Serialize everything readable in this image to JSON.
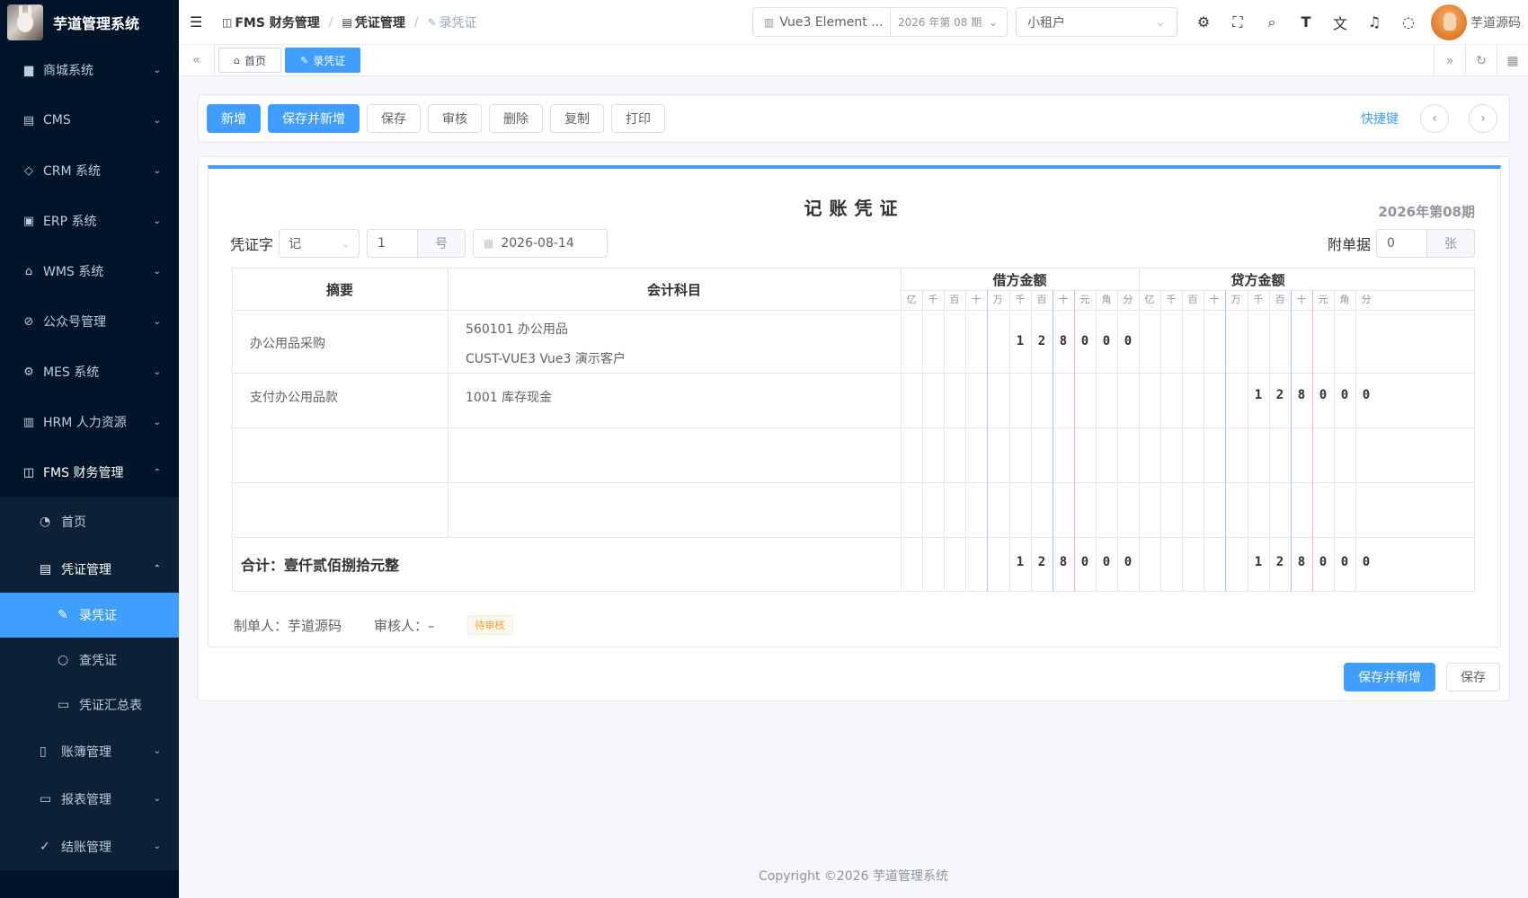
{
  "app": {
    "title": "芋道管理系统"
  },
  "sidebar": {
    "items": [
      {
        "label": "商城系统",
        "icon": "shop-icon"
      },
      {
        "label": "CMS",
        "icon": "document-icon"
      },
      {
        "label": "CRM 系统",
        "icon": "tag-icon"
      },
      {
        "label": "ERP 系统",
        "icon": "erp-icon"
      },
      {
        "label": "WMS 系统",
        "icon": "warehouse-icon"
      },
      {
        "label": "公众号管理",
        "icon": "compass-icon"
      },
      {
        "label": "MES 系统",
        "icon": "chip-icon"
      },
      {
        "label": "HRM 人力资源",
        "icon": "building-icon"
      },
      {
        "label": "FMS 财务管理",
        "icon": "finance-icon"
      }
    ],
    "fms_sub": {
      "home": "首页",
      "voucher_mgmt": "凭证管理",
      "record_voucher": "录凭证",
      "query_voucher": "查凭证",
      "voucher_summary": "凭证汇总表",
      "ledger_mgmt": "账簿管理",
      "report_mgmt": "报表管理",
      "closing_mgmt": "结账管理"
    }
  },
  "header": {
    "breadcrumb": [
      "FMS 财务管理",
      "凭证管理",
      "录凭证"
    ],
    "ledger": "Vue3 Element ...",
    "period": "2026 年第 08 期",
    "tenant": "小租户",
    "user": "芋道源码"
  },
  "tags": {
    "home": "首页",
    "current": "录凭证"
  },
  "toolbar": {
    "add": "新增",
    "save_and_add": "保存并新增",
    "save": "保存",
    "audit": "审核",
    "delete": "删除",
    "copy": "复制",
    "print": "打印",
    "shortcut": "快捷键"
  },
  "voucher": {
    "title": "记账凭证",
    "period_label": "2026年第08期",
    "word_label": "凭证字",
    "word_value": "记",
    "number": "1",
    "number_suffix": "号",
    "date": "2026-08-14",
    "attach_label": "附单据",
    "attach_count": "0",
    "attach_suffix": "张",
    "col_summary": "摘要",
    "col_account": "会计科目",
    "col_debit": "借方金额",
    "col_credit": "贷方金额",
    "units": [
      "亿",
      "千",
      "百",
      "十",
      "万",
      "千",
      "百",
      "十",
      "元",
      "角",
      "分"
    ],
    "rows": [
      {
        "summary": "办公用品采购",
        "account": "560101 办公用品",
        "account_sub": "CUST-VUE3 Vue3 演示客户",
        "debit": [
          "",
          "",
          "",
          "",
          "",
          "1",
          "2",
          "8",
          "0",
          "0",
          "0"
        ],
        "credit": [
          "",
          "",
          "",
          "",
          "",
          "",
          "",
          "",
          "",
          "",
          ""
        ]
      },
      {
        "summary": "支付办公用品款",
        "account": "1001 库存现金",
        "account_sub": "",
        "debit": [
          "",
          "",
          "",
          "",
          "",
          "",
          "",
          "",
          "",
          "",
          ""
        ],
        "credit": [
          "",
          "",
          "",
          "",
          "",
          "1",
          "2",
          "8",
          "0",
          "0",
          "0"
        ]
      }
    ],
    "total_label": "合计：壹仟贰佰捌拾元整",
    "total_debit": [
      "",
      "",
      "",
      "",
      "",
      "1",
      "2",
      "8",
      "0",
      "0",
      "0"
    ],
    "total_credit": [
      "",
      "",
      "",
      "",
      "",
      "1",
      "2",
      "8",
      "0",
      "0",
      "0"
    ],
    "maker_label": "制单人：芋道源码",
    "auditor_label": "审核人：–",
    "status": "待审核"
  },
  "footer_actions": {
    "save_and_add": "保存并新增",
    "save": "保存"
  },
  "copyright": "Copyright ©2026 芋道管理系统"
}
